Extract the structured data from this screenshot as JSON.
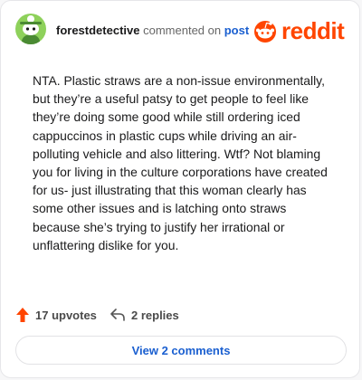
{
  "comment": {
    "username": "forestdetective",
    "action_text": "commented on",
    "target_link": "post",
    "body": "NTA. Plastic straws are a non-issue environmentally, but they’re a useful patsy to get people to feel like they’re doing some good while still ordering iced cappuccinos in plastic cups while driving an air-polluting vehicle and also littering. Wtf? Not blaming you for living in the culture corporations have created for us- just illustrating that this woman clearly has some other issues and is latching onto straws because she’s trying to justify her irrational or unflattering dislike for you.",
    "upvotes_label": "17 upvotes",
    "replies_label": "2 replies",
    "view_comments_label": "View 2 comments"
  },
  "brand": {
    "logo_text": "reddit",
    "accent_color": "#ff4500",
    "link_color": "#1a5fd0",
    "avatar_color": "#8ed15b"
  },
  "icons": {
    "avatar": "snoo-avatar-icon",
    "logo": "reddit-alien-icon",
    "upvote": "upvote-arrow-icon",
    "reply": "reply-arrow-icon"
  }
}
